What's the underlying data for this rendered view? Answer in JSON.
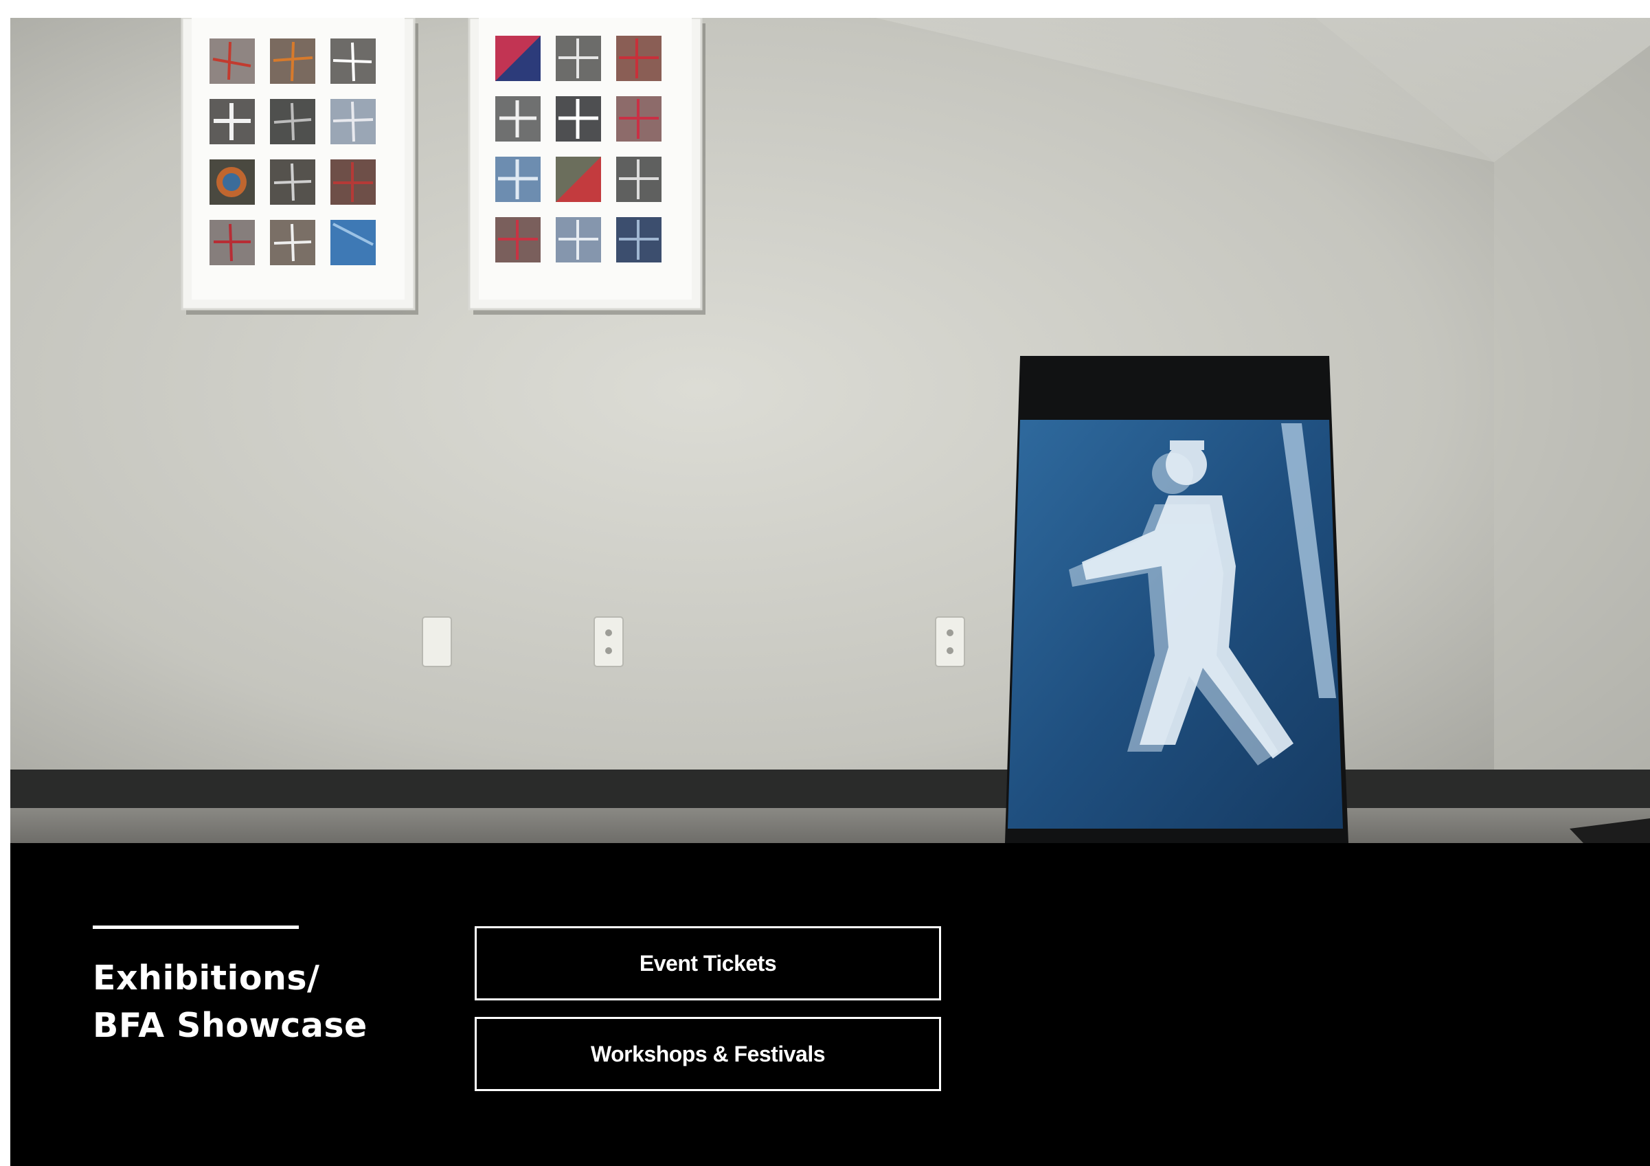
{
  "section": {
    "title_line1": "Exhibitions/",
    "title_line2": "BFA Showcase"
  },
  "buttons": {
    "event_tickets": "Event Tickets",
    "workshops_festivals": "Workshops & Festivals"
  },
  "colors": {
    "panel_bg": "#000000",
    "text": "#ffffff",
    "accent": "#ffffff",
    "wall": "#c9c9c2",
    "screen_blue": "#2a5c8f"
  }
}
